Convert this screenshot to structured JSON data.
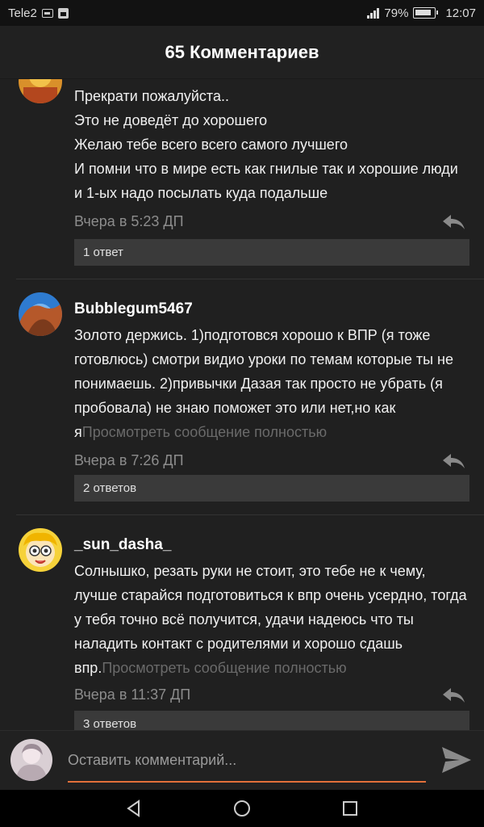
{
  "status_bar": {
    "carrier": "Tele2",
    "battery": "79%",
    "time": "12:07"
  },
  "header": {
    "title": "65 Комментариев"
  },
  "comments": [
    {
      "username": "",
      "text_lines": [
        "Прекрати пожалуйста..",
        "Это не доведёт до хорошего",
        "Желаю тебе всего всего самого лучшего",
        " И помни что в мире есть как гнилые так и хорошие люди и  1-ых  надо посылать куда подальше"
      ],
      "time": "Вчера в 5:23 ДП",
      "answers": "1 ответ"
    },
    {
      "username": "Bubblegum5467",
      "text": "Золото держись. 1)подготовся хорошо к ВПР (я тоже готовлюсь) смотри видио уроки по темам которые ты не понимаешь. 2)привычки Дазая так просто не убрать (я пробовала) не знаю поможет это или нет,но как я",
      "more": "Просмотреть сообщение полностью",
      "time": "Вчера в 7:26 ДП",
      "answers": "2 ответов"
    },
    {
      "username": "_sun_dasha_",
      "text": "Солнышко, резать руки не стоит, это тебе не к чему, лучше старайся подготовиться к впр очень усердно, тогда у тебя точно всё получится, удачи надеюсь что ты наладить контакт с родителями и хорошо сдашь впр.",
      "more": "Просмотреть сообщение полностью",
      "time": "Вчера в 11:37 ДП",
      "answers": "3 ответов"
    }
  ],
  "composer": {
    "placeholder": "Оставить комментарий..."
  },
  "colors": {
    "accent": "#e2703a",
    "background": "#202020",
    "answers_bg": "#3a3a3a"
  },
  "icons": [
    "sim-icon",
    "calendar-icon",
    "signal-icon",
    "battery-icon",
    "reply-icon",
    "send-icon",
    "back-icon",
    "home-icon",
    "recents-icon"
  ]
}
